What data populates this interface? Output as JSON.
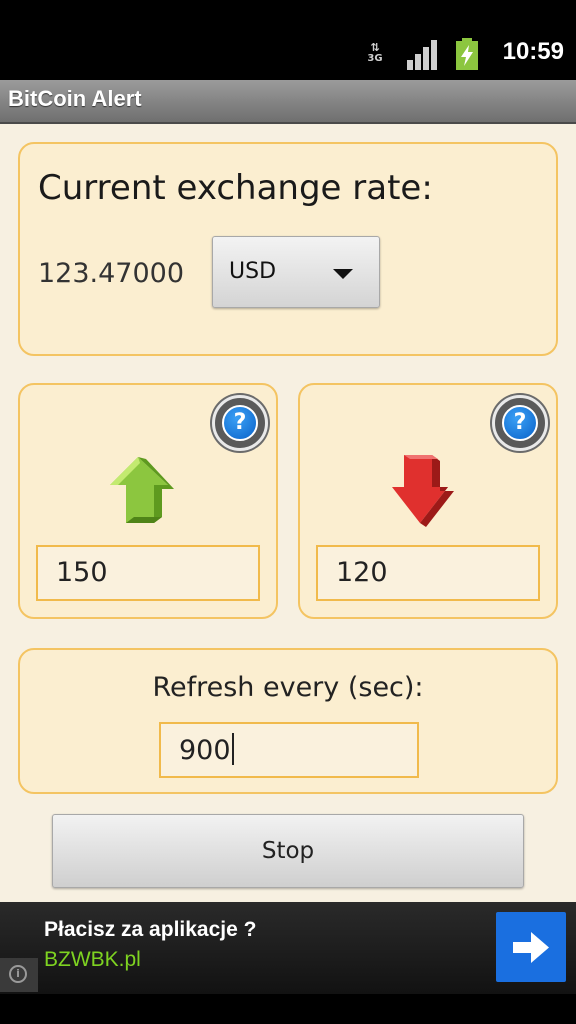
{
  "status_bar": {
    "network": "3G",
    "time": "10:59"
  },
  "title_bar": {
    "title": "BitCoin Alert"
  },
  "rate_panel": {
    "heading": "Current exchange rate:",
    "value": "123.47000",
    "currency": "USD"
  },
  "alerts": {
    "upper": {
      "value": "150",
      "help_label": "?"
    },
    "lower": {
      "value": "120",
      "help_label": "?"
    }
  },
  "refresh": {
    "label": "Refresh every (sec):",
    "value": "900"
  },
  "stop_button": {
    "label": "Stop"
  },
  "ad": {
    "title": "Płacisz za aplikacje ?",
    "url": "BZWBK.pl",
    "info_label": "i"
  },
  "colors": {
    "background": "#f7f0e1",
    "panel_fill": "#fbeed0",
    "panel_border": "#f4c462",
    "ad_url_color": "#7ed321",
    "ad_button": "#1a6fe0"
  },
  "icons": {
    "up_arrow": "green-up-arrow-icon",
    "down_arrow": "red-down-arrow-icon",
    "help": "help-icon",
    "ad_go": "arrow-right-icon"
  }
}
